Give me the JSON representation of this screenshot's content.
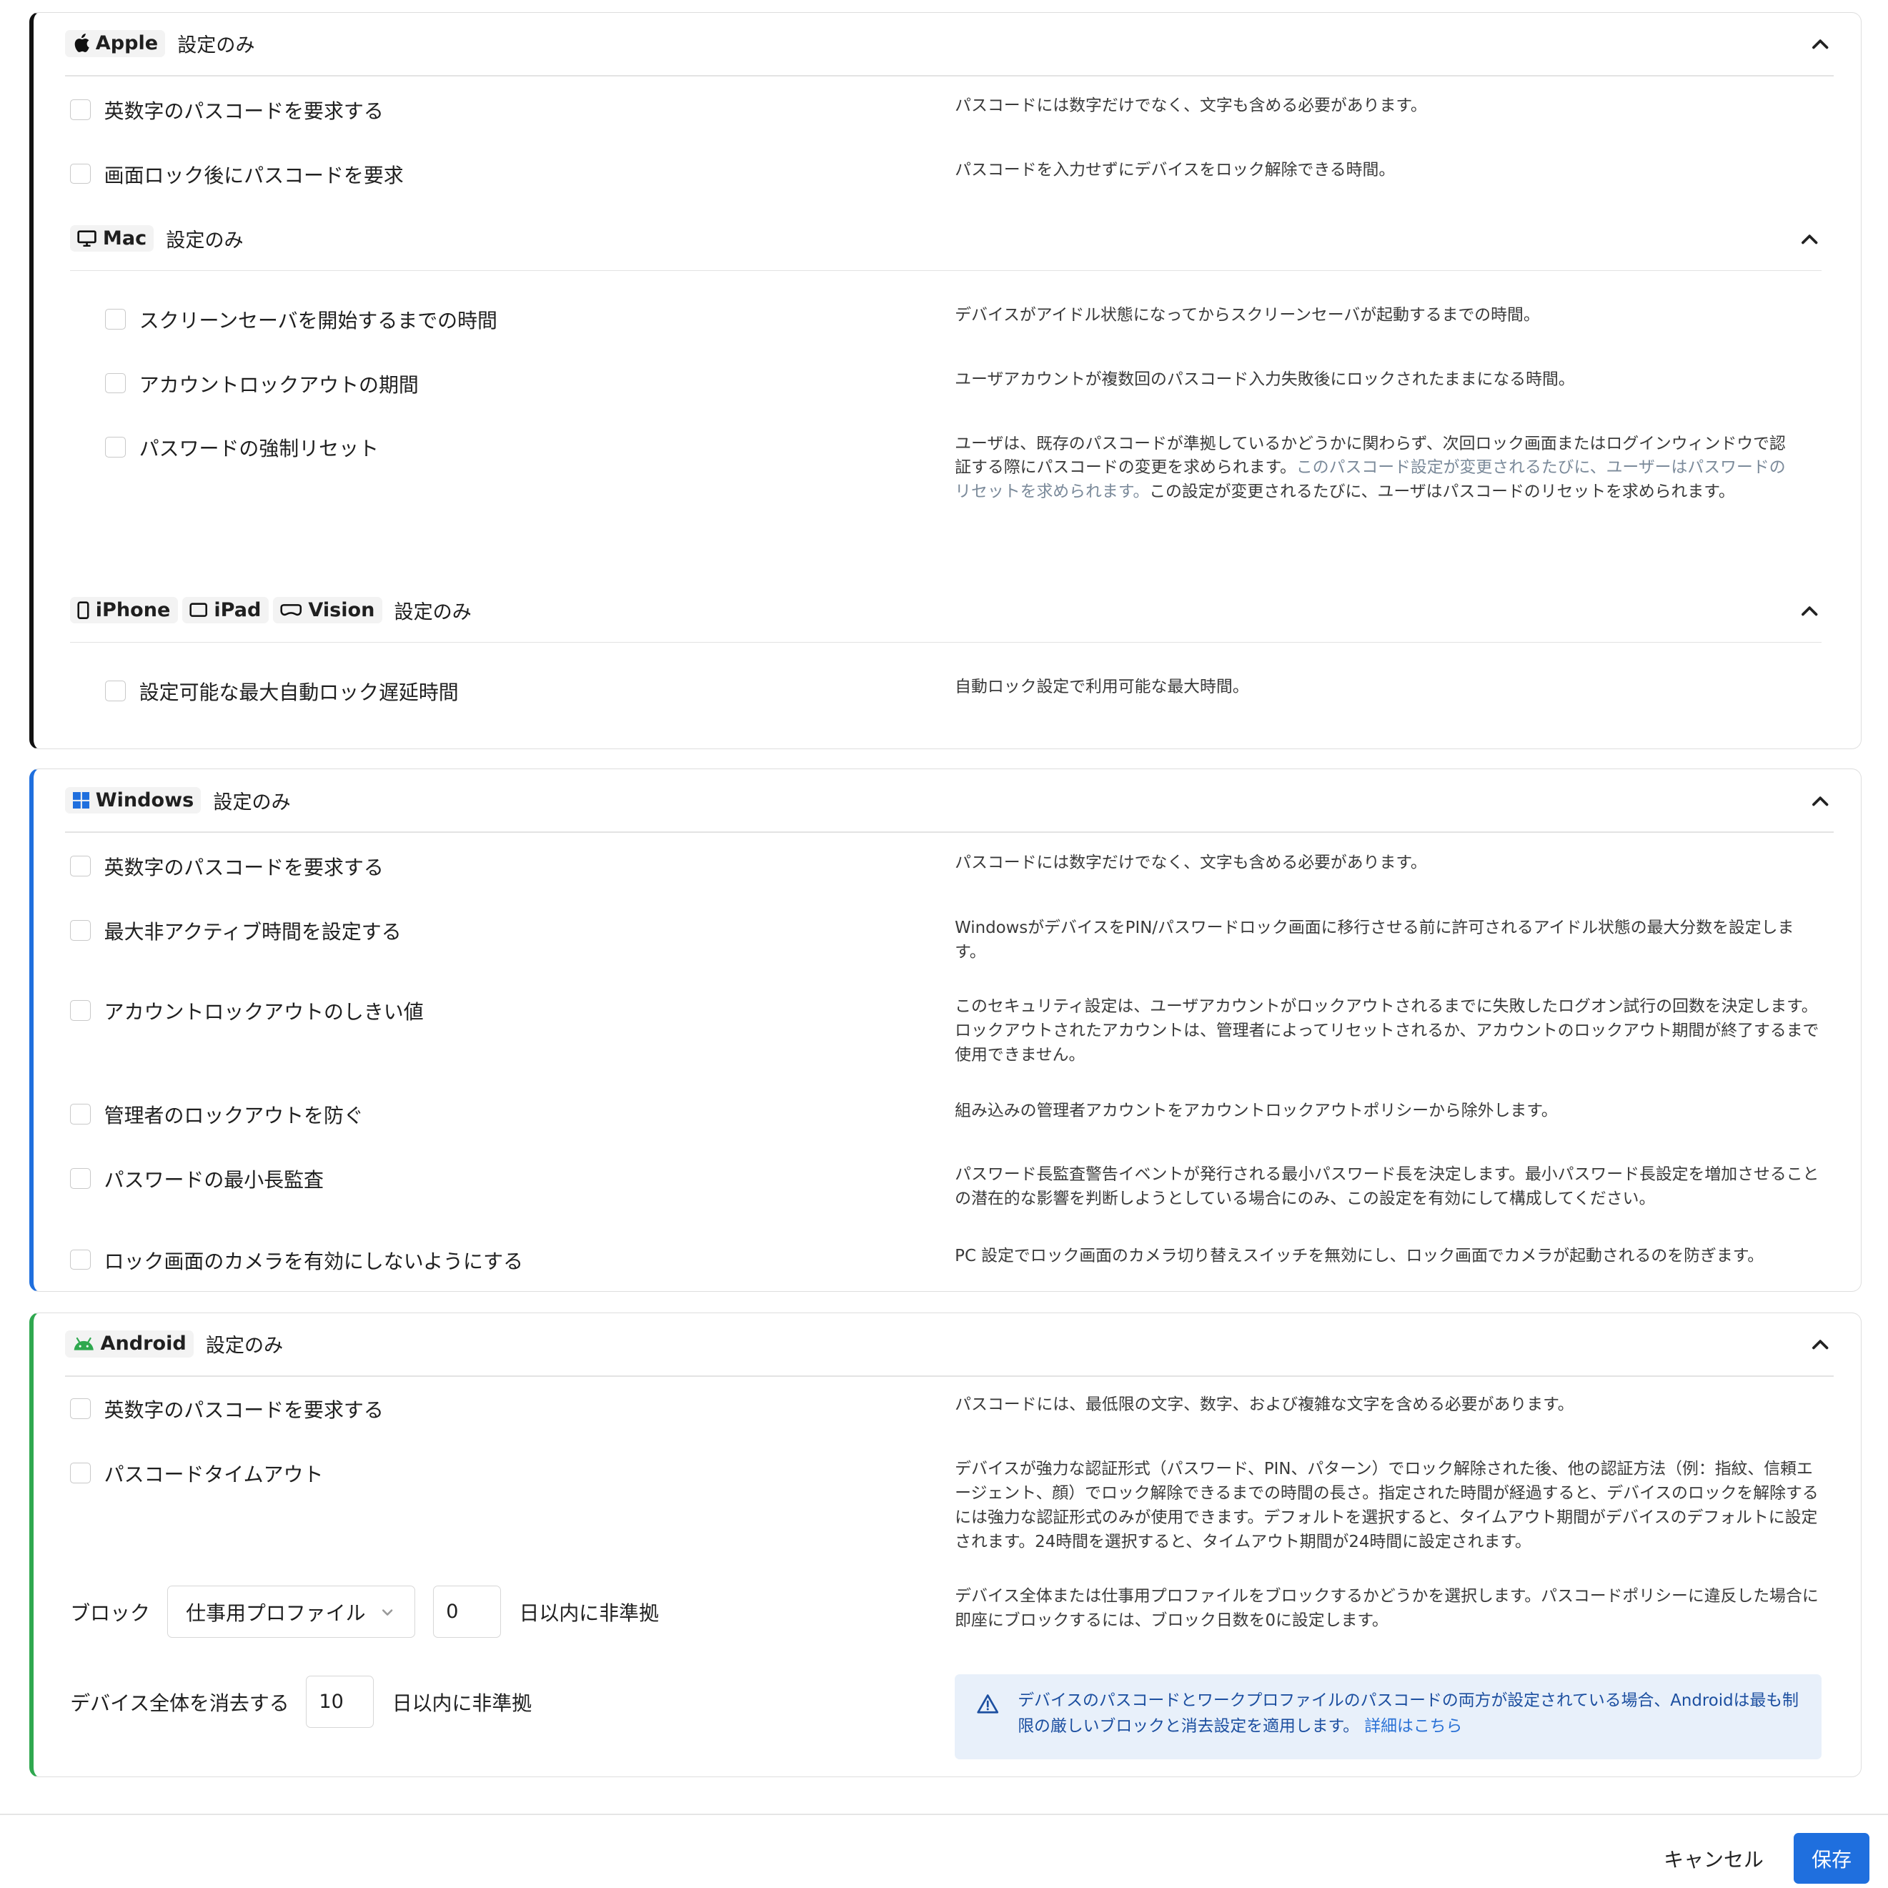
{
  "apple": {
    "platform": "Apple",
    "suffix": "設定のみ",
    "items": [
      {
        "label": "英数字のパスコードを要求する",
        "desc": "パスコードには数字だけでなく、文字も含める必要があります。"
      },
      {
        "label": "画面ロック後にパスコードを要求",
        "desc": "パスコードを入力せずにデバイスをロック解除できる時間。"
      }
    ],
    "mac": {
      "platform": "Mac",
      "suffix": "設定のみ",
      "items": [
        {
          "label": "スクリーンセーバを開始するまでの時間",
          "desc": "デバイスがアイドル状態になってからスクリーンセーバが起動するまでの時間。"
        },
        {
          "label": "アカウントロックアウトの期間",
          "desc": "ユーザアカウントが複数回のパスコード入力失敗後にロックされたままになる時間。"
        },
        {
          "label": "パスワードの強制リセット",
          "desc_a": "ユーザは、既存のパスコードが準拠しているかどうかに関わらず、次回ロック画面またはログインウィンドウで認証する際にパスコードの変更を求められます。",
          "desc_muted": "このパスコード設定が変更されるたびに、ユーザーはパスワードのリセットを求められます。",
          "desc_b": "この設定が変更されるたびに、ユーザはパスコードのリセットを求められます。"
        }
      ]
    },
    "mobile": {
      "chips": [
        "iPhone",
        "iPad",
        "Vision"
      ],
      "suffix": "設定のみ",
      "items": [
        {
          "label": "設定可能な最大自動ロック遅延時間",
          "desc": "自動ロック設定で利用可能な最大時間。"
        }
      ]
    }
  },
  "windows": {
    "platform": "Windows",
    "suffix": "設定のみ",
    "items": [
      {
        "label": "英数字のパスコードを要求する",
        "desc": "パスコードには数字だけでなく、文字も含める必要があります。"
      },
      {
        "label": "最大非アクティブ時間を設定する",
        "desc": "WindowsがデバイスをPIN/パスワードロック画面に移行させる前に許可されるアイドル状態の最大分数を設定します。"
      },
      {
        "label": "アカウントロックアウトのしきい値",
        "desc": "このセキュリティ設定は、ユーザアカウントがロックアウトされるまでに失敗したログオン試行の回数を決定します。ロックアウトされたアカウントは、管理者によってリセットされるか、アカウントのロックアウト期間が終了するまで使用できません。"
      },
      {
        "label": "管理者のロックアウトを防ぐ",
        "desc": "組み込みの管理者アカウントをアカウントロックアウトポリシーから除外します。"
      },
      {
        "label": "パスワードの最小長監査",
        "desc": "パスワード長監査警告イベントが発行される最小パスワード長を決定します。最小パスワード長設定を増加させることの潜在的な影響を判断しようとしている場合にのみ、この設定を有効にして構成してください。"
      },
      {
        "label": "ロック画面のカメラを有効にしないようにする",
        "desc": "PC 設定でロック画面のカメラ切り替えスイッチを無効にし、ロック画面でカメラが起動されるのを防ぎます。"
      }
    ]
  },
  "android": {
    "platform": "Android",
    "suffix": "設定のみ",
    "items": [
      {
        "label": "英数字のパスコードを要求する",
        "desc": "パスコードには、最低限の文字、数字、および複雑な文字を含める必要があります。"
      },
      {
        "label": "パスコードタイムアウト",
        "desc": "デバイスが強力な認証形式（パスワード、PIN、パターン）でロック解除された後、他の認証方法（例：指紋、信頼エージェント、顔）でロック解除できるまでの時間の長さ。指定された時間が経過すると、デバイスのロックを解除するには強力な認証形式のみが使用できます。デフォルトを選択すると、タイムアウト期間がデバイスのデフォルトに設定されます。24時間を選択すると、タイムアウト期間が24時間に設定されます。"
      }
    ],
    "block": {
      "label": "ブロック",
      "select_value": "仕事用プロファイル",
      "days_value": "0",
      "suffix": "日以内に非準拠",
      "desc": "デバイス全体または仕事用プロファイルをブロックするかどうかを選択します。パスコードポリシーに違反した場合に即座にブロックするには、ブロック日数を0に設定します。"
    },
    "wipe": {
      "label": "デバイス全体を消去する",
      "days_value": "10",
      "suffix": "日以内に非準拠"
    },
    "alert": {
      "text": "デバイスのパスコードとワークプロファイルのパスコードの両方が設定されている場合、Androidは最も制限の厳しいブロックと消去設定を適用します。",
      "link": "詳細はこちら"
    }
  },
  "footer": {
    "cancel": "キャンセル",
    "save": "保存"
  },
  "colors": {
    "apple_accent": "#111111",
    "windows_accent": "#1f6fde",
    "android_accent": "#2fa84f",
    "primary": "#1f6fde"
  }
}
